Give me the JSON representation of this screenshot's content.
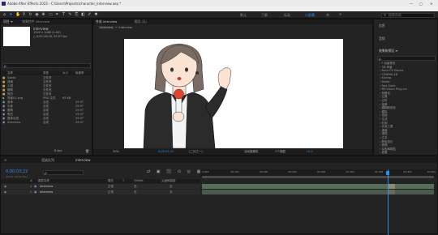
{
  "app": {
    "title": "Adobe After Effects 2023 - C:\\Users\\Projects\\character_interview.aep *"
  },
  "menu": [
    "文件(F)",
    "编辑(E)",
    "合成(C)",
    "图层(L)",
    "效果(T)",
    "动画(A)",
    "视图(V)",
    "窗口",
    "帮助(H)"
  ],
  "workspaces": [
    "默认",
    "了解",
    "标准",
    "小屏幕",
    "库"
  ],
  "search_help": "搜索帮助",
  "project": {
    "tab": "项目 ≡",
    "tab2": "效果控件 interview",
    "comp_name": "interview",
    "comp_info1": "1920 x 1080 (1.00)",
    "comp_info2": "△ 0;00;10;00, 29.97 fps",
    "search_placeholder": "ρ.",
    "columns": [
      "名称",
      "类型",
      "大小",
      "帧速率"
    ],
    "items": [
      {
        "name": "Solids",
        "type": "文件夹",
        "size": "",
        "fps": ""
      },
      {
        "name": "背景",
        "type": "文件夹",
        "size": "",
        "fps": ""
      },
      {
        "name": "人物",
        "type": "文件夹",
        "size": "",
        "fps": ""
      },
      {
        "name": "眼睛",
        "type": "文件夹",
        "size": "",
        "fps": ""
      },
      {
        "name": "嘴巴",
        "type": "文件夹",
        "size": "",
        "fps": ""
      },
      {
        "name": "背景01.png",
        "type": "PNG 文件",
        "size": "65 KB",
        "fps": ""
      },
      {
        "name": "身体",
        "type": "合成",
        "size": "",
        "fps": "29.97"
      },
      {
        "name": "头部",
        "type": "合成",
        "size": "",
        "fps": "29.97"
      },
      {
        "name": "眼睛",
        "type": "合成",
        "size": "",
        "fps": "29.97"
      },
      {
        "name": "嘴巴",
        "type": "合成",
        "size": "",
        "fps": "29.97"
      },
      {
        "name": "整体合成",
        "type": "合成",
        "size": "",
        "fps": "29.97"
      },
      {
        "name": "interview",
        "type": "合成",
        "size": "",
        "fps": "29.97"
      }
    ],
    "bpc": "8 bpc"
  },
  "viewer": {
    "tab": "合成 interview",
    "layer_tab": "图层 (无)",
    "breadcrumb": [
      "interview",
      "interview"
    ],
    "zoom": "50%",
    "timecode": "0;00;03;22",
    "quality": "(二分之一)",
    "camera": "活动摄像机",
    "views": "1个视图",
    "exposure": "+0.0"
  },
  "right": {
    "info": "信息",
    "audio": "音频",
    "effects_title": "效果和预设 ≡",
    "search_placeholder": "ρ.",
    "effects": [
      "* 动画预设",
      "3D 声道",
      "Boris FX Mocha",
      "CINEMA 4D",
      "Keying",
      "Matte",
      "Red Giant",
      "RE:Vision Plug-ins",
      "风格化",
      "过渡",
      "过时",
      "抠像",
      "模糊和锐化",
      "模拟",
      "扭曲",
      "生成",
      "时间",
      "实用工具",
      "通道",
      "透视",
      "文本",
      "颜色校正",
      "音频",
      "杂色和颗粒",
      "遮罩"
    ]
  },
  "timeline": {
    "tabs": [
      "渲染队列",
      "interview"
    ],
    "timecode": "0;00;03;22",
    "fps": "00112 (29.97 fps)",
    "search_placeholder": "ρ.",
    "columns": [
      "#",
      "图层名称",
      "模式",
      "T",
      "TrkMat",
      "父级和链接"
    ],
    "layers": [
      {
        "num": "1",
        "name": "interview",
        "mode": "正常",
        "trkmat": "无",
        "parent": "无"
      },
      {
        "num": "2",
        "name": "interview",
        "mode": "正常",
        "trkmat": "无",
        "parent": "无"
      }
    ],
    "ruler": [
      "0;00s",
      "00;15s",
      "00;30s",
      "00;45s",
      "01;00s",
      "01;15s",
      "01;30s",
      "01;45s",
      "02;00s"
    ],
    "playhead_fraction": 0.8
  }
}
